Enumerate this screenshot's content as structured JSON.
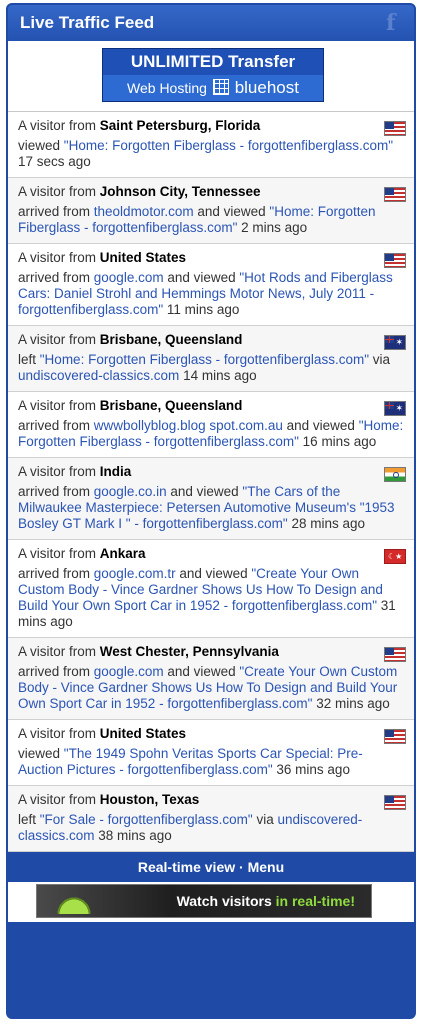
{
  "header": {
    "title": "Live Traffic Feed",
    "icon": "facebook-icon"
  },
  "ad": {
    "top_label": "UNLIMITED Transfer",
    "bottom_left": "Web Hosting",
    "bottom_right": "bluehost"
  },
  "feed": [
    {
      "prefix": "A visitor from",
      "location": "Saint Petersburg, Florida",
      "flag": "us",
      "parts": [
        {
          "t": "viewed "
        },
        {
          "t": "\"Home: Forgotten Fiberglass - forgottenfiberglass.com\"",
          "link": true
        },
        {
          "t": " 17 secs ago"
        }
      ]
    },
    {
      "prefix": "A visitor from",
      "location": "Johnson City, Tennessee",
      "flag": "us",
      "parts": [
        {
          "t": "arrived from "
        },
        {
          "t": "theoldmotor.com",
          "link": true
        },
        {
          "t": " and viewed "
        },
        {
          "t": "\"Home: Forgotten Fiberglass - forgottenfiberglass.com\"",
          "link": true
        },
        {
          "t": " 2 mins ago"
        }
      ]
    },
    {
      "prefix": "A visitor from",
      "location": "United States",
      "flag": "us",
      "parts": [
        {
          "t": "arrived from "
        },
        {
          "t": "google.com",
          "link": true
        },
        {
          "t": " and viewed "
        },
        {
          "t": "\"Hot Rods and Fiberglass Cars: Daniel Strohl and Hemmings Motor News, July 2011 - forgottenfiberglass.com\"",
          "link": true
        },
        {
          "t": " 11 mins ago"
        }
      ]
    },
    {
      "prefix": "A visitor from",
      "location": "Brisbane, Queensland",
      "flag": "au",
      "parts": [
        {
          "t": "left "
        },
        {
          "t": "\"Home: Forgotten Fiberglass - forgottenfiberglass.com\"",
          "link": true
        },
        {
          "t": " via "
        },
        {
          "t": "undiscovered-classics.com",
          "link": true
        },
        {
          "t": " 14 mins ago"
        }
      ]
    },
    {
      "prefix": "A visitor from",
      "location": "Brisbane, Queensland",
      "flag": "au",
      "parts": [
        {
          "t": "arrived from "
        },
        {
          "t": "wwwbollyblog.blog spot.com.au",
          "link": true
        },
        {
          "t": " and viewed "
        },
        {
          "t": "\"Home: Forgotten Fiberglass - forgottenfiberglass.com\"",
          "link": true
        },
        {
          "t": " 16 mins ago"
        }
      ]
    },
    {
      "prefix": "A visitor from",
      "location": "India",
      "flag": "in",
      "parts": [
        {
          "t": "arrived from "
        },
        {
          "t": "google.co.in",
          "link": true
        },
        {
          "t": " and viewed "
        },
        {
          "t": "\"The Cars of the Milwaukee Masterpiece: Petersen Automotive Museum's \"1953 Bosley GT Mark I \" - forgottenfiberglass.com\"",
          "link": true
        },
        {
          "t": " 28 mins ago"
        }
      ]
    },
    {
      "prefix": "A visitor from",
      "location": "Ankara",
      "flag": "tr",
      "parts": [
        {
          "t": "arrived from "
        },
        {
          "t": "google.com.tr",
          "link": true
        },
        {
          "t": " and viewed "
        },
        {
          "t": "\"Create Your Own Custom Body - Vince Gardner Shows Us How To Design and Build Your Own Sport Car in 1952 - forgottenfiberglass.com\"",
          "link": true
        },
        {
          "t": " 31 mins ago"
        }
      ]
    },
    {
      "prefix": "A visitor from",
      "location": "West Chester, Pennsylvania",
      "flag": "us",
      "parts": [
        {
          "t": "arrived from "
        },
        {
          "t": "google.com",
          "link": true
        },
        {
          "t": " and viewed "
        },
        {
          "t": "\"Create Your Own Custom Body - Vince Gardner Shows Us How To Design and Build Your Own Sport Car in 1952 - forgottenfiberglass.com\"",
          "link": true
        },
        {
          "t": " 32 mins ago"
        }
      ]
    },
    {
      "prefix": "A visitor from",
      "location": "United States",
      "flag": "us",
      "parts": [
        {
          "t": "viewed "
        },
        {
          "t": "\"The 1949 Spohn Veritas Sports Car Special: Pre-Auction Pictures - forgottenfiberglass.com\"",
          "link": true
        },
        {
          "t": " 36 mins ago"
        }
      ]
    },
    {
      "prefix": "A visitor from",
      "location": "Houston, Texas",
      "flag": "us",
      "parts": [
        {
          "t": "left "
        },
        {
          "t": "\"For Sale - forgottenfiberglass.com\"",
          "link": true
        },
        {
          "t": " via "
        },
        {
          "t": "undiscovered-classics.com",
          "link": true
        },
        {
          "t": " 38 mins ago"
        }
      ]
    }
  ],
  "footer": {
    "realtime_view": "Real-time view",
    "separator": " · ",
    "menu": "Menu"
  },
  "promo": {
    "text_a": "Watch visitors ",
    "text_b": "in real-time!"
  },
  "colors": {
    "brand": "#1f4aa6",
    "link": "#2b55b5",
    "promo_accent": "#8fdc3f"
  }
}
